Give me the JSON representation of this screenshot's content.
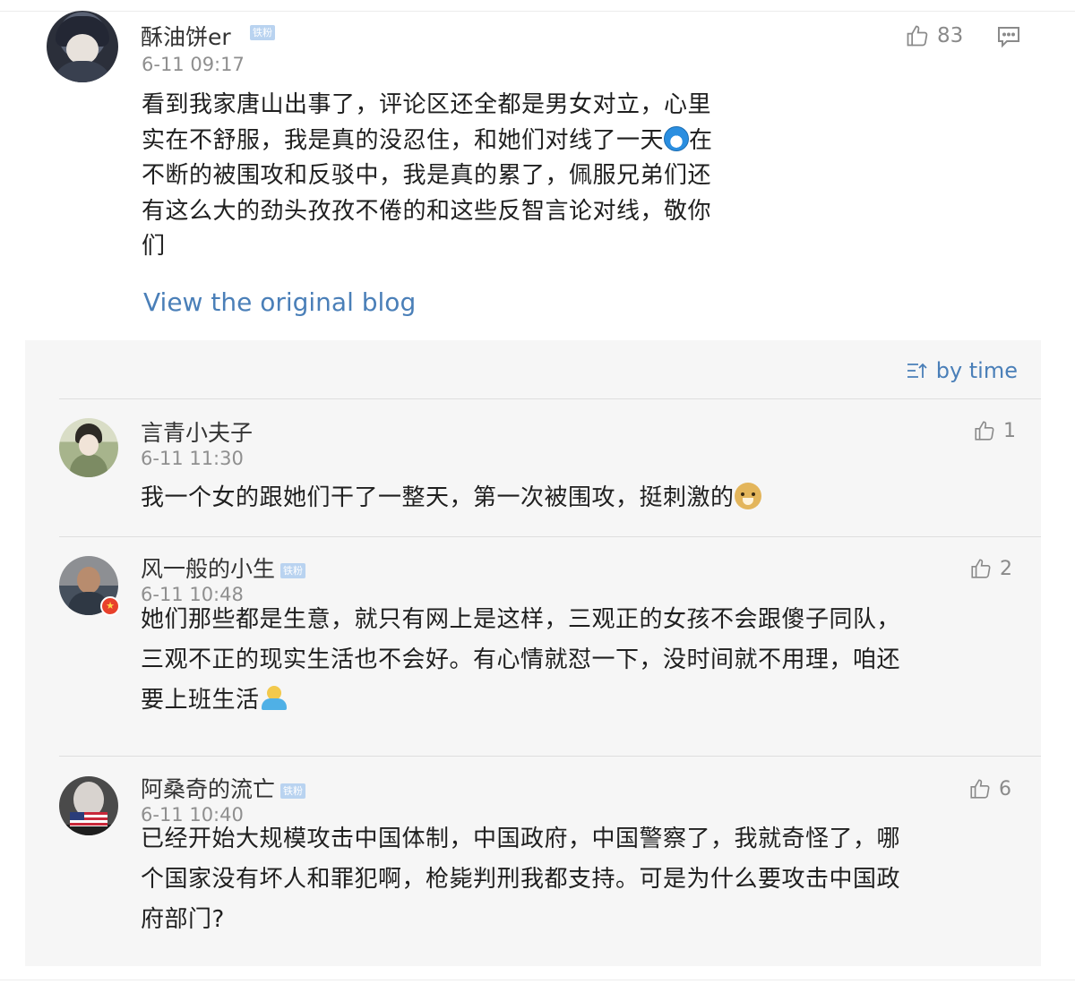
{
  "post": {
    "username": "酥油饼er",
    "badge": "铁粉",
    "time": "6-11 09:17",
    "likes": "83",
    "text_lines": [
      "看到我家唐山出事了，评论区还全都是男女对立，心里",
      "实在不舒服，我是真的没忍住，和她们对线了一天",
      "在",
      "不断的被围攻和反驳中，我是真的累了，佩服兄弟们还",
      "有这么大的劲头孜孜不倦的和这些反智言论对线，敬你",
      "们"
    ],
    "emoji_icon": "doraemon-emoji-icon",
    "view_original": "View the original blog"
  },
  "sort": {
    "label": "by time",
    "icon": "sort-icon"
  },
  "comments": [
    {
      "username": "言青小夫子",
      "time": "6-11 11:30",
      "likes": "1",
      "text": "我一个女的跟她们干了一整天，第一次被围攻，挺刺激的",
      "emoji": "doge-emoji-icon"
    },
    {
      "username": "风一般的小生",
      "badge": "铁粉",
      "time": "6-11 10:48",
      "likes": "2",
      "avatar_badge": "★",
      "text_lines": [
        "她们那些都是生意，就只有网上是这样，三观正的女孩不会跟傻子同队，",
        "三观不正的现实生活也不会好。有心情就怼一下，没时间就不用理，咱还",
        "要上班生活"
      ],
      "emoji": "shrug-emoji-icon"
    },
    {
      "username": "阿桑奇的流亡",
      "badge": "铁粉",
      "time": "6-11 10:40",
      "likes": "6",
      "text_lines": [
        "已经开始大规模攻击中国体制，中国政府，中国警察了，我就奇怪了，哪",
        "个国家没有坏人和罪犯啊，枪毙判刑我都支持。可是为什么要攻击中国政",
        "府部门?"
      ]
    }
  ],
  "colors": {
    "link": "#4a7fb8",
    "badge": "#b9d3f0",
    "panel_bg": "#f6f6f6",
    "meta": "#8f8f8f"
  }
}
